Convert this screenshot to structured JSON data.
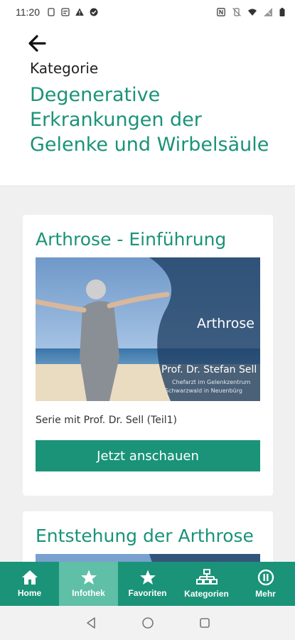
{
  "status_bar": {
    "time": "11:20",
    "icons": [
      "lock-screen-icon",
      "calendar-icon",
      "warning-icon",
      "check-circle-icon",
      "nfc-icon",
      "vibrate-off-icon",
      "wifi-icon",
      "signal-icon",
      "battery-icon"
    ]
  },
  "header": {
    "back_icon": "arrow-left-icon",
    "category_label": "Kategorie",
    "category_title": "Degenerative Erkrankungen der Gelenke und Wirbelsäule"
  },
  "cards": [
    {
      "title": "Arthrose - Einführung",
      "image": {
        "overlay_title": "Arthrose",
        "overlay_name": "Prof. Dr. Stefan Sell",
        "overlay_line1": "Chefarzt im Gelenkzentrum",
        "overlay_line2": "Schwarzwald in Neuenbürg"
      },
      "subtitle": "Serie mit Prof. Dr. Sell (Teil1)",
      "cta": "Jetzt anschauen"
    },
    {
      "title": "Entstehung der Arthrose"
    }
  ],
  "bottom_nav": {
    "items": [
      {
        "label": "Home",
        "icon": "home-icon"
      },
      {
        "label": "Infothek",
        "icon": "star-icon",
        "active": true
      },
      {
        "label": "Favoriten",
        "icon": "star-icon"
      },
      {
        "label": "Kategorien",
        "icon": "sitemap-icon"
      },
      {
        "label": "Mehr",
        "icon": "pause-circle-icon"
      }
    ]
  },
  "colors": {
    "accent": "#1a9378",
    "accent_light": "#5fbfa7",
    "background": "#f0f0f0"
  }
}
